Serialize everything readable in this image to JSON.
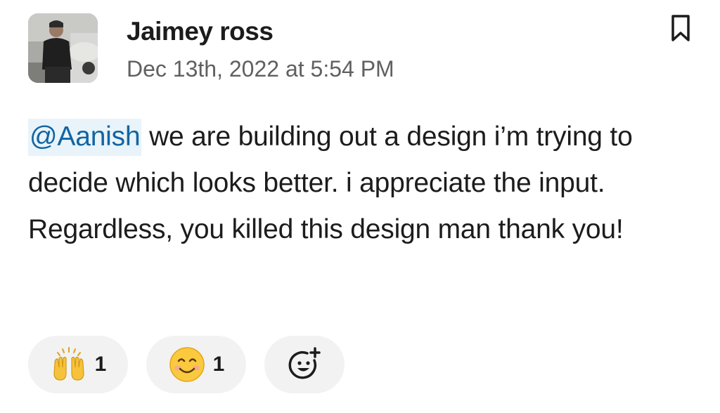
{
  "message": {
    "sender_name": "Jaimey ross",
    "timestamp": "Dec 13th, 2022 at 5:54 PM",
    "mention": "@Aanish",
    "text": " we are building out a design i’m trying to decide which looks better. i appreciate the input. Regardless, you killed this design man thank you!"
  },
  "reactions": [
    {
      "emoji": "raising-hands-icon",
      "count": "1"
    },
    {
      "emoji": "smiling-face-icon",
      "count": "1"
    }
  ],
  "actions": {
    "add_reaction": "add-reaction-icon",
    "save": "bookmark-icon"
  },
  "colors": {
    "mention_bg": "#e8f4fa",
    "mention_text": "#1264a3",
    "timestamp": "#616061",
    "reaction_bg": "#f2f2f2"
  }
}
